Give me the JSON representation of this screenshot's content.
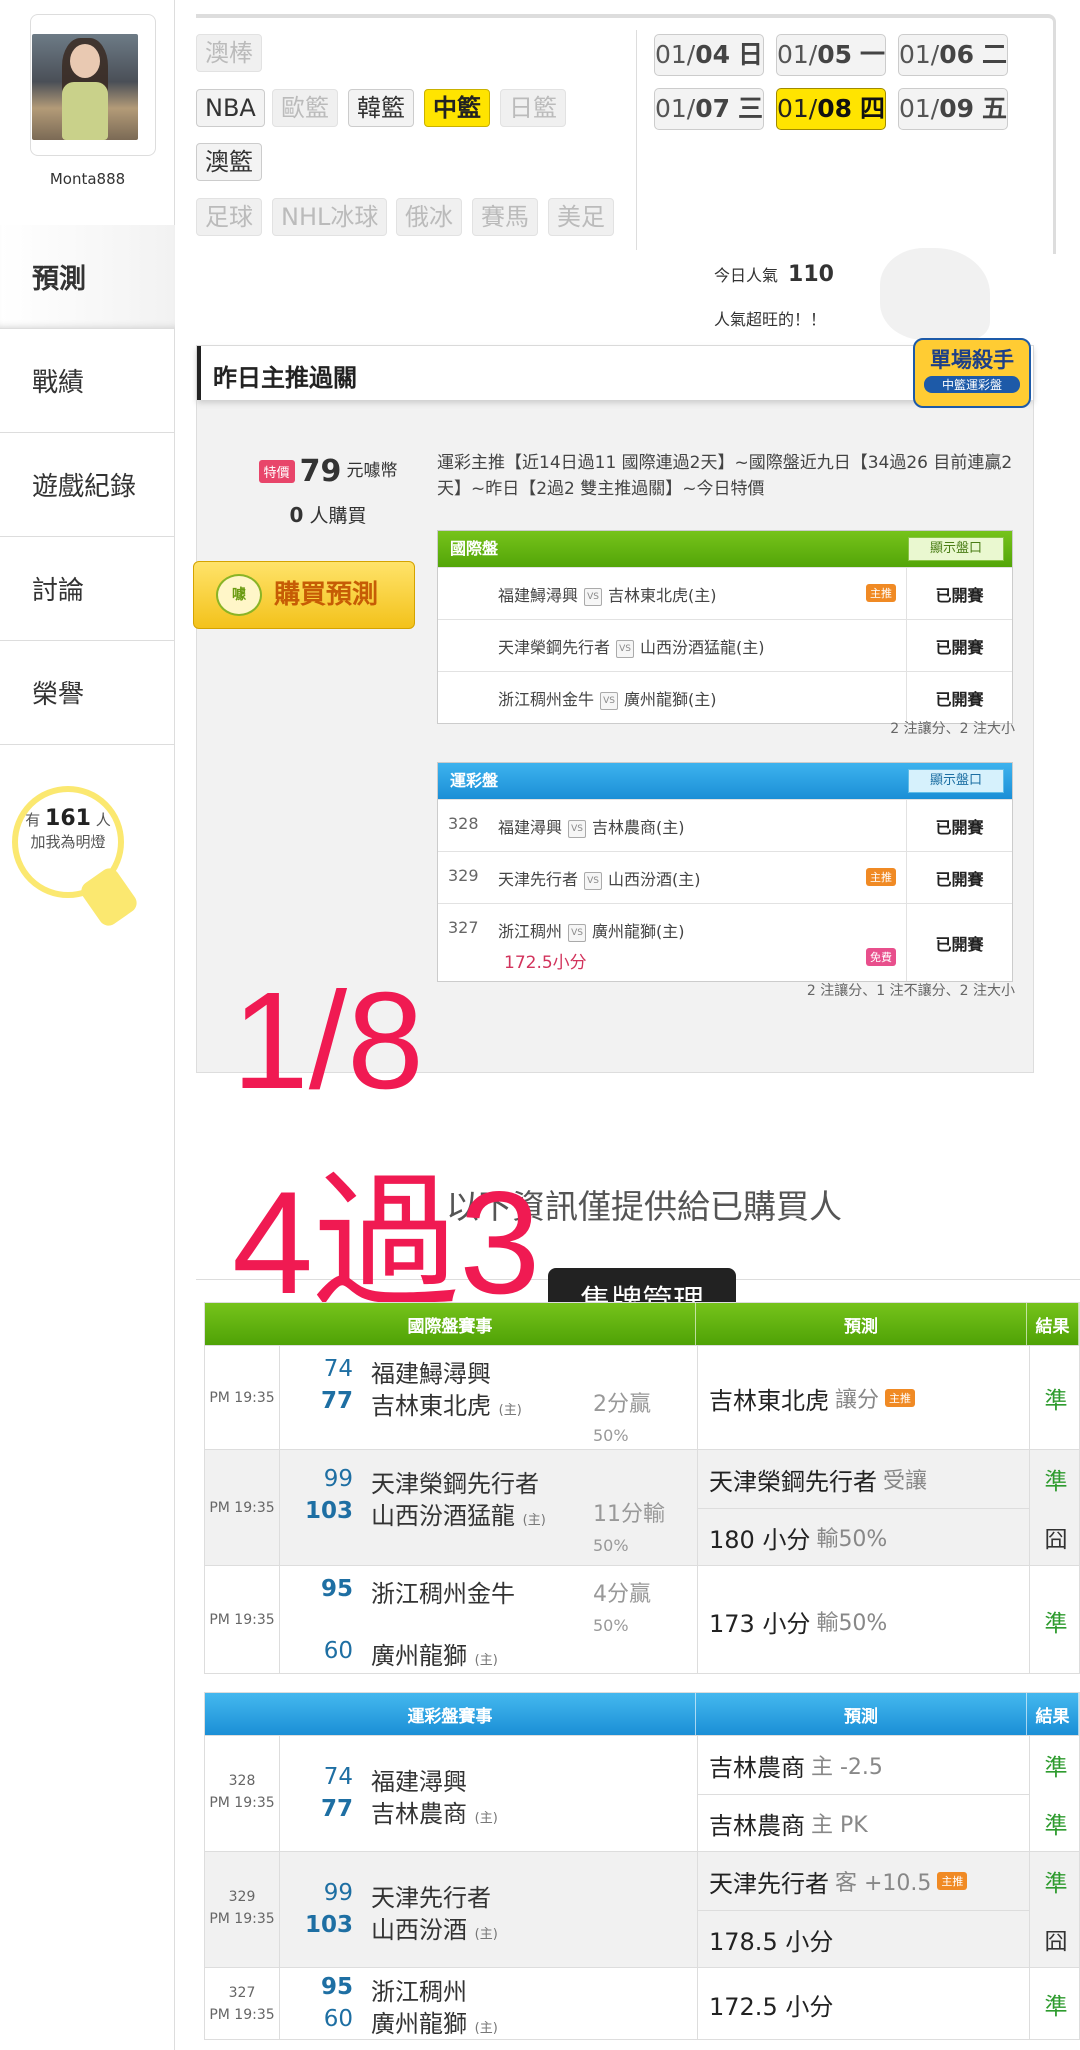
{
  "user": {
    "name": "Monta888"
  },
  "menu": [
    "預測",
    "戰績",
    "遊戲紀錄",
    "討論",
    "榮譽"
  ],
  "bulb": {
    "prefix": "有",
    "count": "161",
    "suffix": "人",
    "line2": "加我為明燈"
  },
  "leagues": {
    "row1": [
      "澳棒"
    ],
    "row2": [
      "NBA",
      "歐籃",
      "韓籃",
      "中籃",
      "日籃"
    ],
    "row3": [
      "澳籃"
    ],
    "row4": [
      "足球",
      "NHL冰球",
      "俄冰",
      "賽馬",
      "美足"
    ]
  },
  "dates": [
    {
      "md": "01/",
      "d": "04",
      "w": "日"
    },
    {
      "md": "01/",
      "d": "05",
      "w": "一"
    },
    {
      "md": "01/",
      "d": "06",
      "w": "二"
    },
    {
      "md": "01/",
      "d": "07",
      "w": "三"
    },
    {
      "md": "01/",
      "d": "08",
      "w": "四"
    },
    {
      "md": "01/",
      "d": "09",
      "w": "五"
    }
  ],
  "popularity": {
    "label": "今日人氣",
    "value": "110",
    "note": "人氣超旺的！！"
  },
  "yesterday": {
    "title": "昨日主推過關",
    "badge_main": "單場殺手",
    "badge_sub": "中籃運彩盤",
    "price_tag": "特價",
    "price": "79",
    "price_unit": "元噱幣",
    "buyers": "0",
    "buyers_label": "人購買",
    "buy_button": "購買預測",
    "buy_icon": "噱",
    "summary": "運彩主推【近14日過11 國際連過2天】~國際盤近九日【34過26 目前連贏2天】~昨日【2過2 雙主推過關】~今日特價",
    "intl": {
      "title": "國際盤",
      "show": "顯示盤口",
      "rows": [
        {
          "home": "福建鱘潯興",
          "away": "吉林東北虎(主)",
          "tag": "主推",
          "status": "已開賽"
        },
        {
          "home": "天津榮鋼先行者",
          "away": "山西汾酒猛龍(主)",
          "tag": "",
          "status": "已開賽"
        },
        {
          "home": "浙江稠州金牛",
          "away": "廣州龍獅(主)",
          "tag": "",
          "status": "已開賽"
        }
      ],
      "note": "2 注讓分、2 注大小"
    },
    "lottery": {
      "title": "運彩盤",
      "show": "顯示盤口",
      "rows": [
        {
          "num": "328",
          "home": "福建潯興",
          "away": "吉林農商(主)",
          "tag": "",
          "extra": "",
          "status": "已開賽"
        },
        {
          "num": "329",
          "home": "天津先行者",
          "away": "山西汾酒(主)",
          "tag": "主推",
          "extra": "",
          "status": "已開賽"
        },
        {
          "num": "327",
          "home": "浙江稠州",
          "away": "廣州龍獅(主)",
          "tag": "免費",
          "extra": "172.5小分",
          "status": "已開賽"
        }
      ],
      "note": "2 注讓分、1 注不讓分、2 注大小"
    }
  },
  "overlay": {
    "date": "1/8",
    "record": "4過3"
  },
  "info_text": "以下資訊僅提供給已購買人",
  "mgmt_button": "售牌管理",
  "intl_results": {
    "headers": [
      "國際盤賽事",
      "預測",
      "結果"
    ],
    "games": [
      {
        "time": "PM 19:35",
        "s1": "74",
        "t1": "福建鱘潯興",
        "s2": "77",
        "t2": "吉林東北虎",
        "home": "(主)",
        "margin": "2分贏",
        "pct": "50%",
        "preds": [
          {
            "team": "吉林東北虎",
            "type": "讓分",
            "tag": "主推",
            "result": "準"
          }
        ]
      },
      {
        "time": "PM 19:35",
        "s1": "99",
        "t1": "天津榮鋼先行者",
        "s2": "103",
        "t2": "山西汾酒猛龍",
        "home": "(主)",
        "margin": "11分輸",
        "pct": "50%",
        "preds": [
          {
            "team": "天津榮鋼先行者",
            "type": "受讓",
            "tag": "",
            "result": "準"
          },
          {
            "team": "180 小分",
            "type": "輸50%",
            "tag": "",
            "result": "囧"
          }
        ]
      },
      {
        "time": "PM 19:35",
        "s1": "95",
        "t1": "浙江稠州金牛",
        "s2": "60",
        "t2": "廣州龍獅",
        "home": "(主)",
        "margin": "4分贏",
        "pct": "50%",
        "preds": [
          {
            "team": "173 小分",
            "type": "輸50%",
            "tag": "",
            "result": "準"
          }
        ]
      }
    ]
  },
  "lottery_results": {
    "headers": [
      "運彩盤賽事",
      "預測",
      "結果"
    ],
    "games": [
      {
        "num": "328",
        "time": "PM 19:35",
        "s1": "74",
        "t1": "福建潯興",
        "s2": "77",
        "t2": "吉林農商",
        "home": "(主)",
        "preds": [
          {
            "team": "吉林農商",
            "type": "主 -2.5",
            "tag": "",
            "result": "準"
          },
          {
            "team": "吉林農商",
            "type": "主 PK",
            "tag": "",
            "result": "準"
          }
        ]
      },
      {
        "num": "329",
        "time": "PM 19:35",
        "s1": "99",
        "t1": "天津先行者",
        "s2": "103",
        "t2": "山西汾酒",
        "home": "(主)",
        "preds": [
          {
            "team": "天津先行者",
            "type": "客 +10.5",
            "tag": "主推",
            "result": "準"
          },
          {
            "team": "178.5 小分",
            "type": "",
            "tag": "",
            "result": "囧"
          }
        ]
      },
      {
        "num": "327",
        "time": "PM 19:35",
        "s1": "95",
        "t1": "浙江稠州",
        "s2": "60",
        "t2": "廣州龍獅",
        "home": "(主)",
        "preds": [
          {
            "team": "172.5 小分",
            "type": "",
            "tag": "",
            "result": "準"
          }
        ]
      }
    ]
  },
  "colors": {
    "accent_yellow": "#ffe400",
    "green_header": "#5cb30f",
    "blue_header": "#2aa0e2",
    "overlay_red": "#f01a52",
    "win_green": "#2e9b2e"
  }
}
